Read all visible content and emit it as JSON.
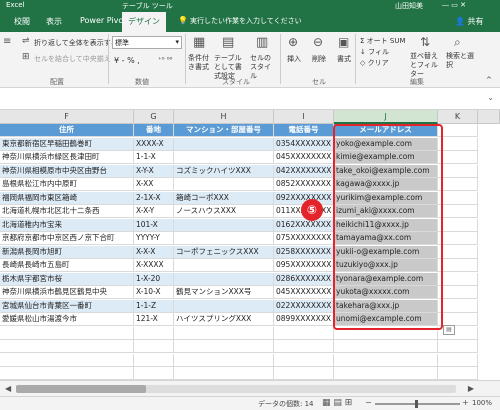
{
  "titlebar": {
    "app": "Excel",
    "context_tool": "テーブル ツール",
    "user": "山田知美"
  },
  "tabs": [
    "校閲",
    "表示",
    "Power Pivot",
    "デザイン"
  ],
  "tell_me": "実行したい作業を入力してください",
  "share": "共有",
  "ribbon": {
    "wrap_text": "折り返して全体を表示する",
    "merge_center": "セルを結合して中央揃え",
    "number_format": "標準",
    "currency_percent": "¥ - % ,",
    "cond_format": "条件付き書式",
    "table_format": "テーブルとして書式設定",
    "cell_styles": "セルのスタイル",
    "insert": "挿入",
    "delete": "削除",
    "format": "書式",
    "autosum": "オート SUM",
    "fill": "フィル",
    "clear": "クリア",
    "sort_filter": "並べ替えとフィルター",
    "find_select": "検索と選択",
    "groups": {
      "alignment": "配置",
      "number": "数値",
      "styles": "スタイル",
      "cells": "セル",
      "editing": "編集"
    }
  },
  "columns": [
    "F",
    "G",
    "H",
    "I",
    "J",
    "K"
  ],
  "headers": [
    "住所",
    "番地",
    "マンション・部屋番号",
    "電話番号",
    "メールアドレス"
  ],
  "rows": [
    [
      "東京都新宿区早稲田鶴巻町",
      "XXXX-X",
      "",
      "0354XXXXXXX",
      "yoko@example.com"
    ],
    [
      "神奈川県横浜市緑区長津田町",
      "1-1-X",
      "",
      "045XXXXXXXX",
      "kimie@example.com"
    ],
    [
      "神奈川県相模原市中央区由野台",
      "X-Y-X",
      "コズミックハイツXXX",
      "042XXXXXXXX",
      "take_okoi@example.com"
    ],
    [
      "島根県松江市内中原町",
      "X-XX",
      "",
      "0852XXXXXXX",
      "kagawa@xxxx.jp"
    ],
    [
      "福岡県福岡市東区箱崎",
      "2-1X-X",
      "箱崎コーポXXX",
      "092XXXXXXXX",
      "yurikim@example.com"
    ],
    [
      "北海道札幌市北区北十二条西",
      "X-X-Y",
      "ノースハウスXXX",
      "011XXXXXXXX",
      "izumi_aki@xxxx.com"
    ],
    [
      "北海道稚内市宝来",
      "101-X",
      "",
      "0162XXXXXXX",
      "heikichi11@xxxx.jp"
    ],
    [
      "京都府京都市中京区西ノ京下合町",
      "YYYY-Y",
      "",
      "075XXXXXXXX",
      "tamayama@xx.com"
    ],
    [
      "新潟県長岡市旭町",
      "X-X-X",
      "コーポフェニックスXXX",
      "0258XXXXXXX",
      "yukii-o@example.com"
    ],
    [
      "長崎県長崎市五島町",
      "X-XXXX",
      "",
      "095XXXXXXXX",
      "tuzukiyo@xxx.jp"
    ],
    [
      "栃木県宇都宮市桜",
      "1-X-20",
      "",
      "0286XXXXXXX",
      "tyonara@example.com"
    ],
    [
      "神奈川県横浜市鶴見区鶴見中央",
      "X-10-X",
      "鶴見マンションXXX号",
      "045XXXXXXXX",
      "yukota@xxxxx.com"
    ],
    [
      "宮城県仙台市青葉区一番町",
      "1-1-Z",
      "",
      "022XXXXXXXX",
      "takehara@xxx.jp"
    ],
    [
      "愛媛県松山市湯渡今市",
      "121-X",
      "ハイツスプリングXXX",
      "0899XXXXXXX",
      "unomi@excample.com"
    ]
  ],
  "annotation": "⑤",
  "status": {
    "count": "データの個数: 14",
    "zoom": "100%"
  },
  "colors": {
    "excel_green": "#217346",
    "table_header": "#5b9bd5",
    "band": "#ddebf7",
    "highlight": "#e3242b"
  }
}
